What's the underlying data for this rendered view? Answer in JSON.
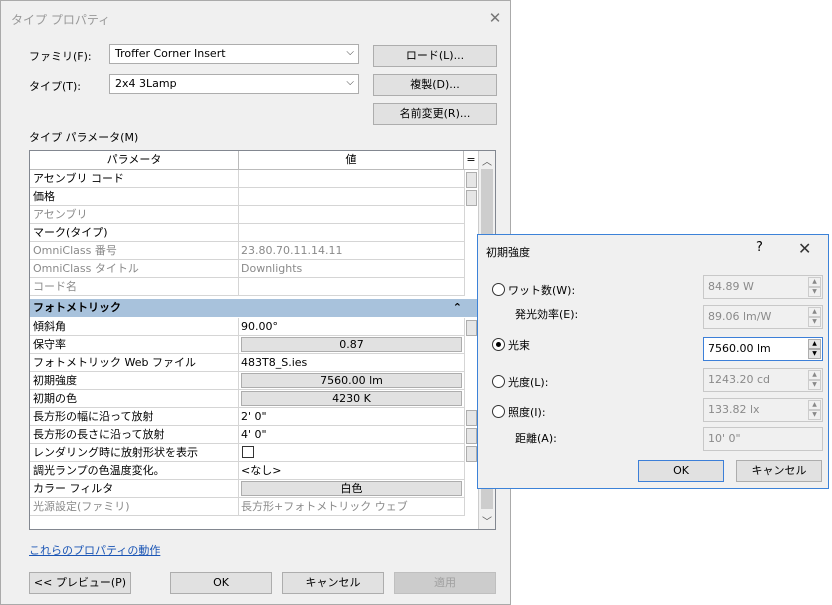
{
  "main": {
    "title": "タイプ プロパティ",
    "family_label": "ファミリ(F):",
    "family_value": "Troffer Corner Insert",
    "type_label": "タイプ(T):",
    "type_value": "2x4 3Lamp",
    "load_button": "ロード(L)...",
    "duplicate_button": "複製(D)...",
    "rename_button": "名前変更(R)...",
    "type_params_label": "タイプ パラメータ(M)",
    "col_param": "パラメータ",
    "col_value": "値",
    "col_eq": "=",
    "rows_top": [
      {
        "name": "アセンブリ コード",
        "value": "",
        "gray": false
      },
      {
        "name": "価格",
        "value": "",
        "gray": false
      },
      {
        "name": "アセンブリ",
        "value": "",
        "gray": true
      },
      {
        "name": "マーク(タイプ)",
        "value": "",
        "gray": false
      },
      {
        "name": "OmniClass 番号",
        "value": "23.80.70.11.14.11",
        "gray": true
      },
      {
        "name": "OmniClass タイトル",
        "value": "Downlights",
        "gray": true
      },
      {
        "name": "コード名",
        "value": "",
        "gray": true
      }
    ],
    "group_photometric": "フォトメトリック",
    "group_collapse": "⌃",
    "rows_photo": [
      {
        "name": "傾斜角",
        "value": "90.00°"
      },
      {
        "name": "保守率",
        "value": "0.87"
      },
      {
        "name": "フォトメトリック Web ファイル",
        "value": "483T8_S.ies"
      },
      {
        "name": "初期強度",
        "value": "7560.00 lm"
      },
      {
        "name": "初期の色",
        "value": "4230 K"
      },
      {
        "name": "長方形の幅に沿って放射",
        "value": "2'  0\""
      },
      {
        "name": "長方形の長さに沿って放射",
        "value": "4'  0\""
      },
      {
        "name": "レンダリング時に放射形状を表示",
        "value": ""
      },
      {
        "name": "調光ランプの色温度変化。",
        "value": "<なし>"
      },
      {
        "name": "カラー フィルタ",
        "value": "白色"
      },
      {
        "name": "光源設定(ファミリ)",
        "value": "長方形+フォトメトリック ウェブ"
      }
    ],
    "link": "これらのプロパティの動作",
    "preview_button": "<< プレビュー(P)",
    "ok_button": "OK",
    "cancel_button": "キャンセル",
    "apply_button": "適用"
  },
  "popup": {
    "title": "初期強度",
    "help": "?",
    "close": "✕",
    "wattage_label": "ワット数(W):",
    "wattage_value": "84.89 W",
    "efficacy_label": "発光効率(E):",
    "efficacy_value": "89.06 lm/W",
    "flux_label": "光束",
    "flux_value": "7560.00 lm",
    "luminous_label": "光度(L):",
    "luminous_value": "1243.20 cd",
    "illum_label": "照度(I):",
    "illum_value": "133.82 lx",
    "distance_label": "距離(A):",
    "distance_value": "10'  0\"",
    "ok_button": "OK",
    "cancel_button": "キャンセル"
  }
}
